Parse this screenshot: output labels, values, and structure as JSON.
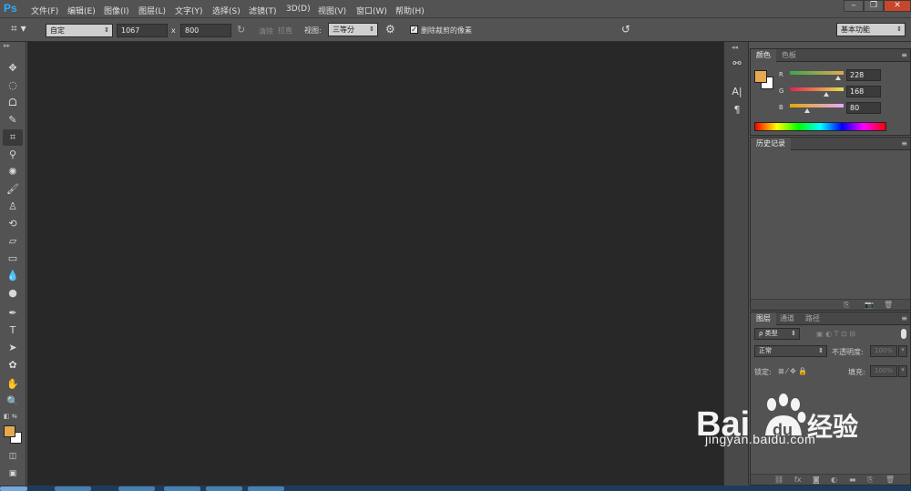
{
  "app": {
    "logo": "Ps"
  },
  "menu": [
    "文件(F)",
    "编辑(E)",
    "图像(I)",
    "图层(L)",
    "文字(Y)",
    "选择(S)",
    "滤镜(T)",
    "3D(D)",
    "视图(V)",
    "窗口(W)",
    "帮助(H)"
  ],
  "window_buttons": {
    "minimize": "–",
    "restore": "❐",
    "close": "✕"
  },
  "options_bar": {
    "ratio_preset": "自定",
    "width": "1067",
    "times": "x",
    "height": "800",
    "clear_label": "清除",
    "straighten_label": "拉直",
    "view_label": "视图:",
    "view_value": "三等分",
    "delete_cropped_label": "删除裁剪的像素",
    "delete_cropped_checked": true,
    "workspace": "基本功能"
  },
  "tools": [
    "move-tool",
    "marquee-tool",
    "lasso-tool",
    "quick-select-tool",
    "crop-tool",
    "eyedropper-tool",
    "spot-heal-tool",
    "brush-tool",
    "clone-stamp-tool",
    "history-brush-tool",
    "eraser-tool",
    "gradient-tool",
    "blur-tool",
    "dodge-tool",
    "pen-tool",
    "type-tool",
    "path-select-tool",
    "shape-tool",
    "hand-tool",
    "zoom-tool"
  ],
  "colors": {
    "foreground": "#e4a850",
    "background": "#ffffff"
  },
  "color_panel": {
    "tabs": [
      "颜色",
      "色板"
    ],
    "channels": [
      {
        "label": "R",
        "value": "228"
      },
      {
        "label": "G",
        "value": "168"
      },
      {
        "label": "B",
        "value": "80"
      }
    ]
  },
  "history_panel": {
    "tabs": [
      "历史记录"
    ]
  },
  "layers_panel": {
    "tabs": [
      "图层",
      "通道",
      "路径"
    ],
    "filter_kind": "ρ 类型",
    "blend_mode": "正常",
    "opacity_label": "不透明度:",
    "opacity_value": "100%",
    "lock_label": "锁定:",
    "fill_label": "填充:",
    "fill_value": "100%"
  },
  "watermark": {
    "brand": "Bai",
    "paw": "du",
    "cn": "经验",
    "url": "jingyan.baidu.com"
  }
}
